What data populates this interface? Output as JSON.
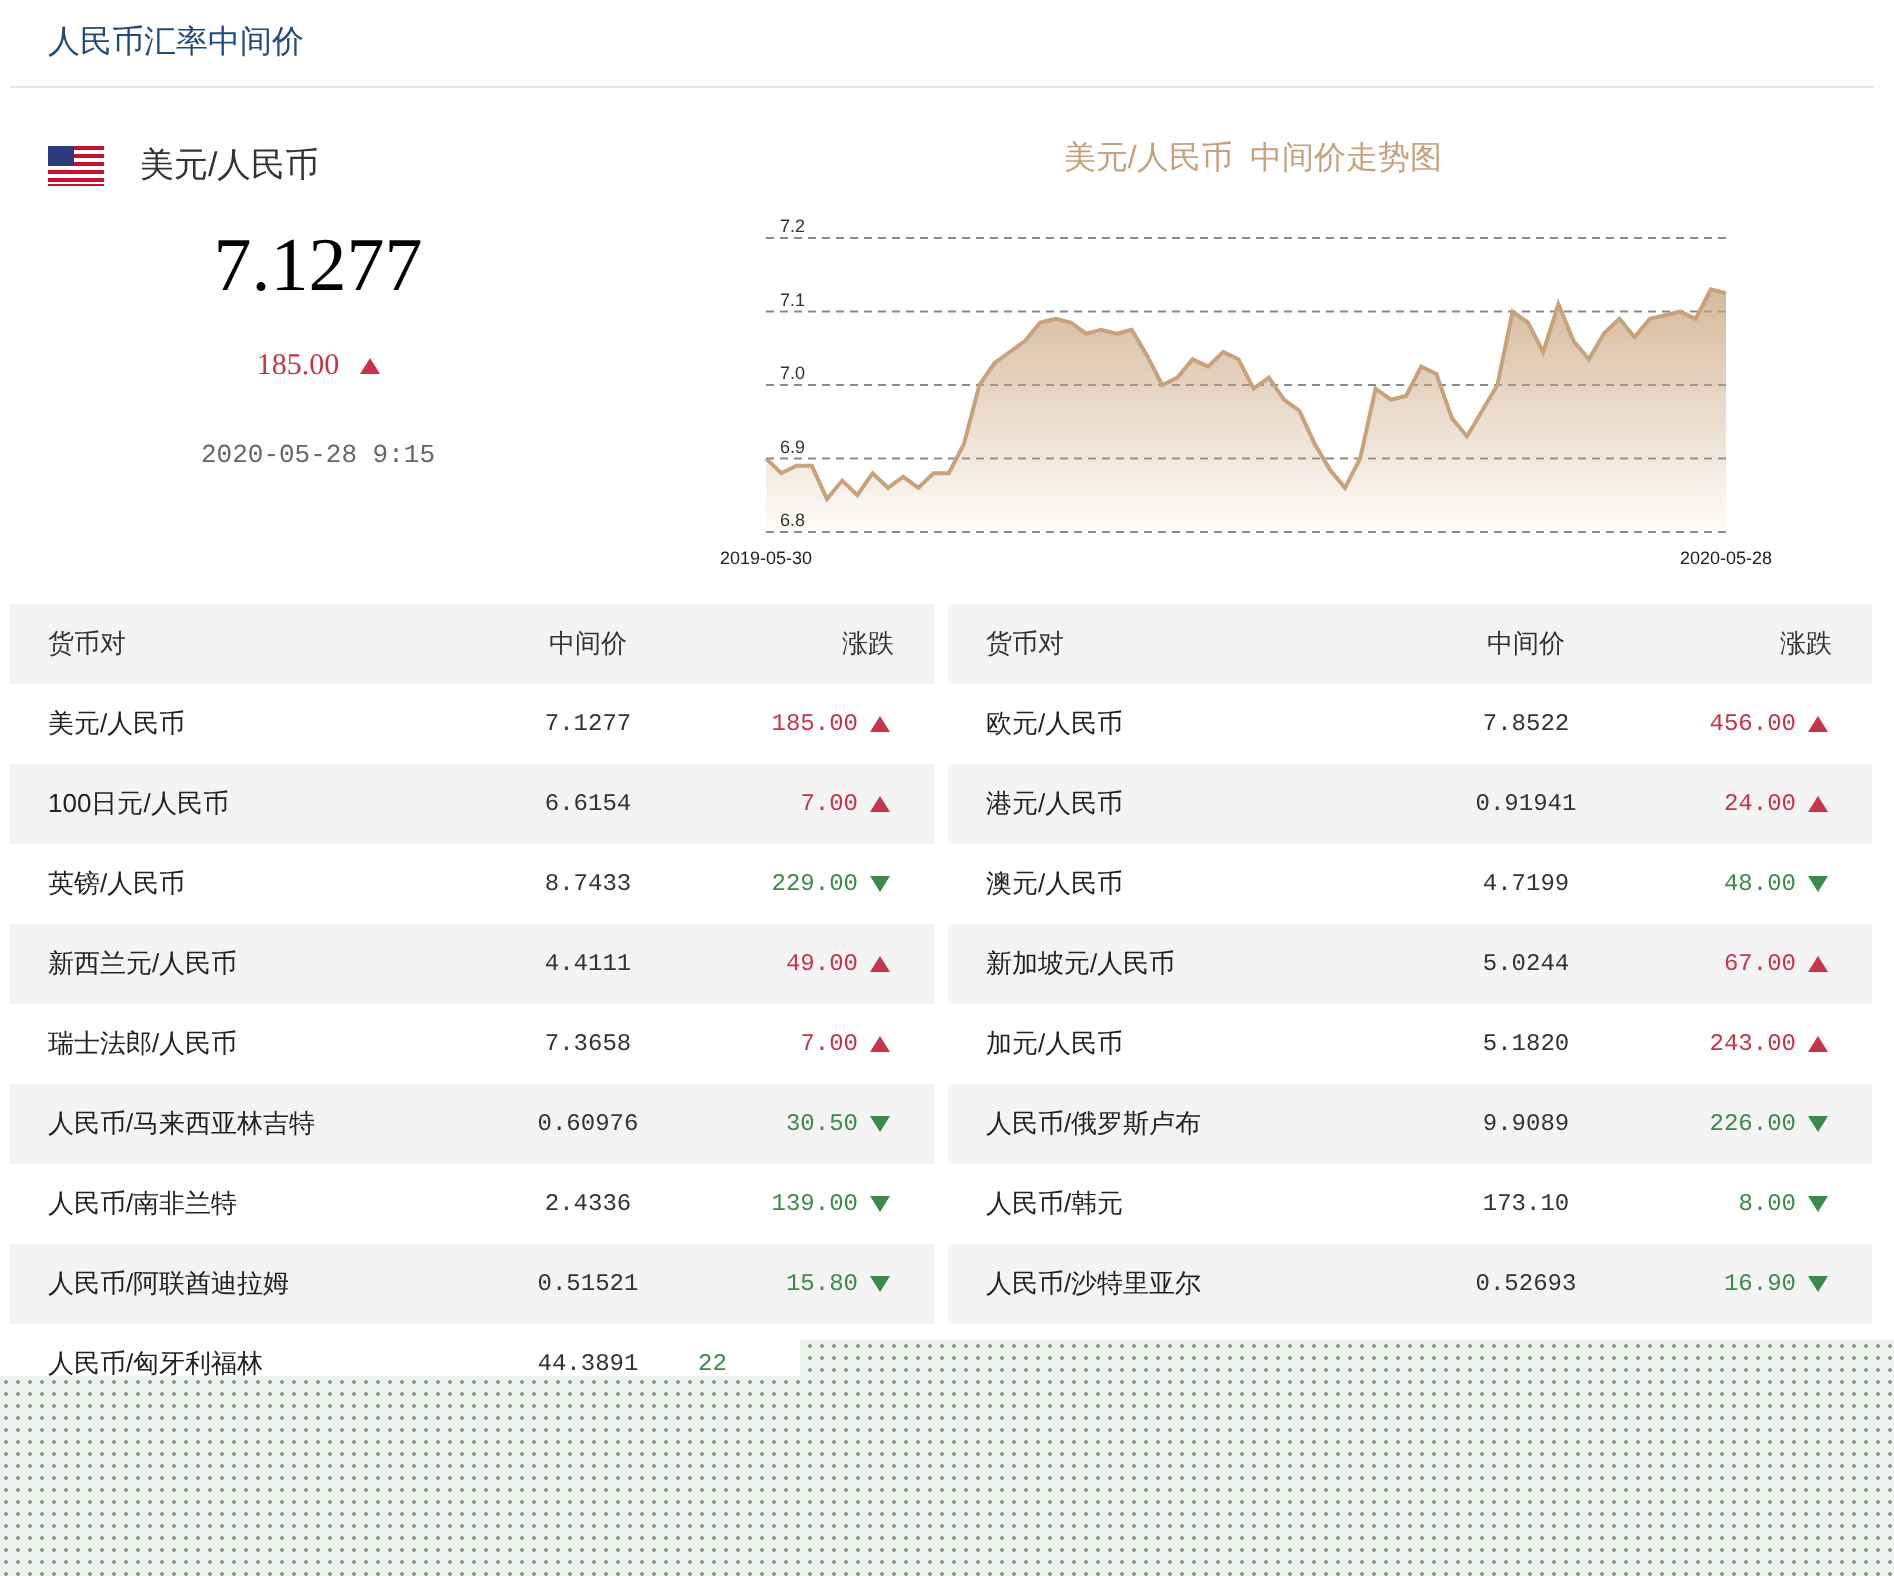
{
  "page_title": "人民币汇率中间价",
  "featured": {
    "pair": "美元/人民币",
    "rate": "7.1277",
    "change": "185.00",
    "kind": "up",
    "time": "2020-05-28 9:15"
  },
  "chart": {
    "chart_data": {
      "type": "area",
      "title": "美元/人民币  中间价走势图",
      "categories": [
        "2019-05-30",
        null,
        null,
        null,
        null,
        null,
        null,
        null,
        null,
        null,
        null,
        null,
        null,
        null,
        null,
        null,
        null,
        null,
        null,
        null,
        null,
        null,
        null,
        null,
        null,
        null,
        null,
        null,
        null,
        null,
        null,
        null,
        null,
        null,
        null,
        null,
        null,
        null,
        null,
        null,
        null,
        null,
        null,
        null,
        null,
        null,
        null,
        null,
        null,
        null,
        null,
        null,
        null,
        null,
        null,
        null,
        null,
        null,
        null,
        null,
        null,
        null,
        null,
        "2020-05-28"
      ],
      "series": [
        {
          "color": "#c8a27a",
          "values": [
            6.9,
            6.88,
            6.89,
            6.89,
            6.845,
            6.87,
            6.85,
            6.88,
            6.86,
            6.875,
            6.86,
            6.88,
            6.88,
            6.92,
            7.0,
            7.03,
            7.045,
            7.06,
            7.085,
            7.09,
            7.085,
            7.07,
            7.075,
            7.07,
            7.075,
            7.04,
            7.0,
            7.01,
            7.035,
            7.025,
            7.045,
            7.035,
            6.995,
            7.01,
            6.98,
            6.965,
            6.92,
            6.885,
            6.86,
            6.9,
            6.995,
            6.98,
            6.985,
            7.025,
            7.015,
            6.955,
            6.93,
            6.965,
            7.0,
            7.1,
            7.085,
            7.045,
            7.11,
            7.06,
            7.035,
            7.07,
            7.09,
            7.065,
            7.09,
            7.095,
            7.1,
            7.09,
            7.13,
            7.125
          ]
        }
      ],
      "grid": true,
      "ylim": [
        6.8,
        7.2
      ],
      "yticks": [
        {
          "value": 6.8,
          "label": "6.8"
        },
        {
          "value": 6.9,
          "label": "6.9"
        },
        {
          "value": 7,
          "label": "7.0"
        },
        {
          "value": 7.1,
          "label": "7.1"
        },
        {
          "value": 7.2,
          "label": "7.2"
        }
      ]
    }
  },
  "tables": [
    {
      "columns": [
        "货币对",
        "中间价",
        "涨跌"
      ],
      "rows": [
        {
          "pair": "美元/人民币",
          "mid": "7.1277",
          "change": "185.00",
          "kind": "up"
        },
        {
          "pair": "100日元/人民币",
          "mid": "6.6154",
          "change": "7.00",
          "kind": "up"
        },
        {
          "pair": "英镑/人民币",
          "mid": "8.7433",
          "change": "229.00",
          "kind": "down"
        },
        {
          "pair": "新西兰元/人民币",
          "mid": "4.4111",
          "change": "49.00",
          "kind": "up"
        },
        {
          "pair": "瑞士法郎/人民币",
          "mid": "7.3658",
          "change": "7.00",
          "kind": "up"
        },
        {
          "pair": "人民币/马来西亚林吉特",
          "mid": "0.60976",
          "change": "30.50",
          "kind": "down"
        },
        {
          "pair": "人民币/南非兰特",
          "mid": "2.4336",
          "change": "139.00",
          "kind": "down"
        },
        {
          "pair": "人民币/阿联酋迪拉姆",
          "mid": "0.51521",
          "change": "15.80",
          "kind": "down"
        },
        {
          "pair": "人民币/匈牙利福林",
          "mid": "44.3891",
          "change": "22"
        }
      ]
    },
    {
      "columns": [
        "货币对",
        "中间价",
        "涨跌"
      ],
      "rows": [
        {
          "pair": "欧元/人民币",
          "mid": "7.8522",
          "change": "456.00",
          "kind": "up"
        },
        {
          "pair": "港元/人民币",
          "mid": "0.91941",
          "change": "24.00",
          "kind": "up"
        },
        {
          "pair": "澳元/人民币",
          "mid": "4.7199",
          "change": "48.00",
          "kind": "down"
        },
        {
          "pair": "新加坡元/人民币",
          "mid": "5.0244",
          "change": "67.00",
          "kind": "up"
        },
        {
          "pair": "加元/人民币",
          "mid": "5.1820",
          "change": "243.00",
          "kind": "up"
        },
        {
          "pair": "人民币/俄罗斯卢布",
          "mid": "9.9089",
          "change": "226.00",
          "kind": "down"
        },
        {
          "pair": "人民币/韩元",
          "mid": "173.10",
          "change": "8.00",
          "kind": "down"
        },
        {
          "pair": "人民币/沙特里亚尔",
          "mid": "0.52693",
          "change": "16.90",
          "kind": "down"
        }
      ]
    }
  ]
}
